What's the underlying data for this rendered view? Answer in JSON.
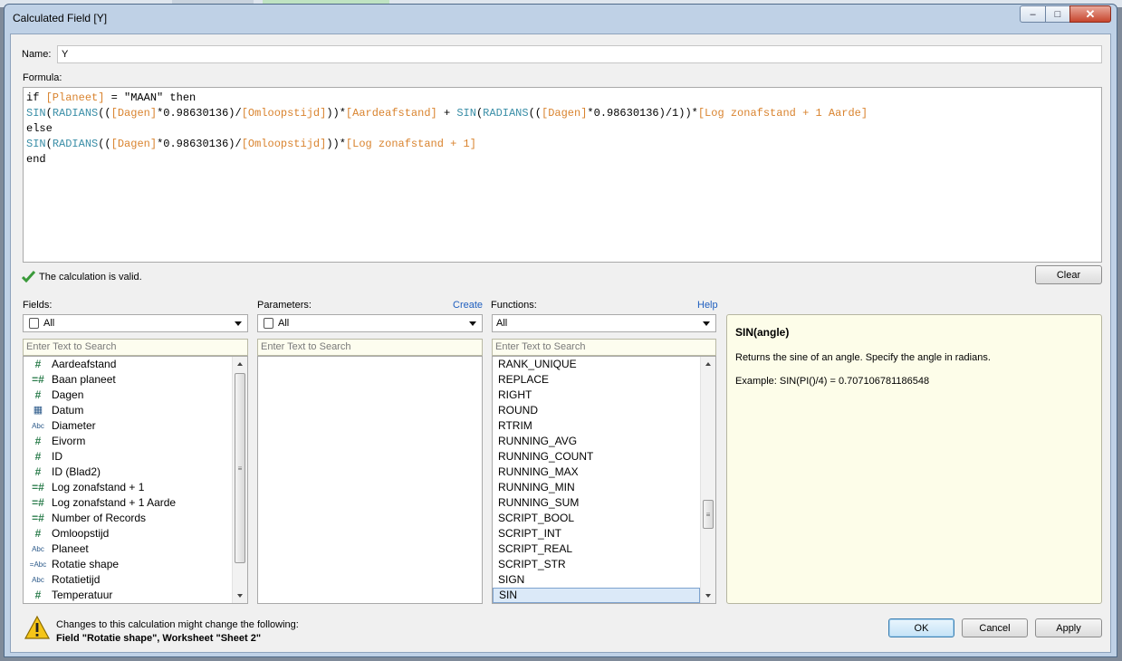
{
  "window": {
    "title": "Calculated Field [Y]",
    "controls": {
      "minimize": "–",
      "maximize": "□",
      "close": "✕"
    }
  },
  "name": {
    "label": "Name:",
    "value": "Y"
  },
  "formula": {
    "label": "Formula:",
    "lines": [
      [
        {
          "t": "kw",
          "s": "if "
        },
        {
          "t": "fld",
          "s": "[Planeet]"
        },
        {
          "t": "kw",
          "s": " = \"MAAN\" then"
        }
      ],
      [
        {
          "t": "fn",
          "s": "SIN"
        },
        {
          "t": "kw",
          "s": "("
        },
        {
          "t": "fn",
          "s": "RADIANS"
        },
        {
          "t": "kw",
          "s": "(("
        },
        {
          "t": "fld",
          "s": "[Dagen]"
        },
        {
          "t": "kw",
          "s": "*0.98630136)/"
        },
        {
          "t": "fld",
          "s": "[Omloopstijd]"
        },
        {
          "t": "kw",
          "s": "))*"
        },
        {
          "t": "fld",
          "s": "[Aardeafstand]"
        },
        {
          "t": "kw",
          "s": " + "
        },
        {
          "t": "fn",
          "s": "SIN"
        },
        {
          "t": "kw",
          "s": "("
        },
        {
          "t": "fn",
          "s": "RADIANS"
        },
        {
          "t": "kw",
          "s": "(("
        },
        {
          "t": "fld",
          "s": "[Dagen]"
        },
        {
          "t": "kw",
          "s": "*0.98630136)/1))*"
        },
        {
          "t": "fld",
          "s": "[Log zonafstand + 1 Aarde]"
        }
      ],
      [
        {
          "t": "kw",
          "s": "else"
        }
      ],
      [
        {
          "t": "fn",
          "s": "SIN"
        },
        {
          "t": "kw",
          "s": "("
        },
        {
          "t": "fn",
          "s": "RADIANS"
        },
        {
          "t": "kw",
          "s": "(("
        },
        {
          "t": "fld",
          "s": "[Dagen]"
        },
        {
          "t": "kw",
          "s": "*0.98630136)/"
        },
        {
          "t": "fld",
          "s": "[Omloopstijd]"
        },
        {
          "t": "kw",
          "s": "))*"
        },
        {
          "t": "fld",
          "s": "[Log zonafstand + 1]"
        }
      ],
      [
        {
          "t": "kw",
          "s": "end"
        }
      ]
    ]
  },
  "status": {
    "text": "The calculation is valid."
  },
  "buttons": {
    "clear": "Clear",
    "ok": "OK",
    "cancel": "Cancel",
    "apply": "Apply"
  },
  "fields": {
    "label": "Fields:",
    "filter": "All",
    "search_placeholder": "Enter Text to Search",
    "items": [
      {
        "icon": "#",
        "name": "Aardeafstand"
      },
      {
        "icon": "=#",
        "name": "Baan planeet"
      },
      {
        "icon": "#",
        "name": "Dagen"
      },
      {
        "icon": "cal",
        "name": "Datum"
      },
      {
        "icon": "Abc",
        "name": "Diameter"
      },
      {
        "icon": "#",
        "name": "Eivorm"
      },
      {
        "icon": "#",
        "name": "ID"
      },
      {
        "icon": "#",
        "name": "ID (Blad2)"
      },
      {
        "icon": "=#",
        "name": "Log zonafstand + 1"
      },
      {
        "icon": "=#",
        "name": "Log zonafstand + 1 Aarde"
      },
      {
        "icon": "=#",
        "name": "Number of Records"
      },
      {
        "icon": "#",
        "name": "Omloopstijd"
      },
      {
        "icon": "Abc",
        "name": "Planeet"
      },
      {
        "icon": "=Abc",
        "name": "Rotatie shape"
      },
      {
        "icon": "Abc",
        "name": "Rotatietijd"
      },
      {
        "icon": "#",
        "name": "Temperatuur"
      }
    ]
  },
  "parameters": {
    "label": "Parameters:",
    "create_link": "Create",
    "filter": "All",
    "search_placeholder": "Enter Text to Search"
  },
  "functions": {
    "label": "Functions:",
    "help_link": "Help",
    "filter": "All",
    "search_placeholder": "Enter Text to Search",
    "items": [
      "RANK_UNIQUE",
      "REPLACE",
      "RIGHT",
      "ROUND",
      "RTRIM",
      "RUNNING_AVG",
      "RUNNING_COUNT",
      "RUNNING_MAX",
      "RUNNING_MIN",
      "RUNNING_SUM",
      "SCRIPT_BOOL",
      "SCRIPT_INT",
      "SCRIPT_REAL",
      "SCRIPT_STR",
      "SIGN",
      "SIN"
    ],
    "selected": "SIN"
  },
  "help": {
    "title": "SIN(angle)",
    "description": "Returns the sine of an angle. Specify the angle in radians.",
    "example": "Example: SIN(PI()/4) = 0.707106781186548"
  },
  "warning": {
    "line1": "Changes to this calculation might change the following:",
    "line2": "Field \"Rotatie shape\", Worksheet \"Sheet 2\""
  }
}
